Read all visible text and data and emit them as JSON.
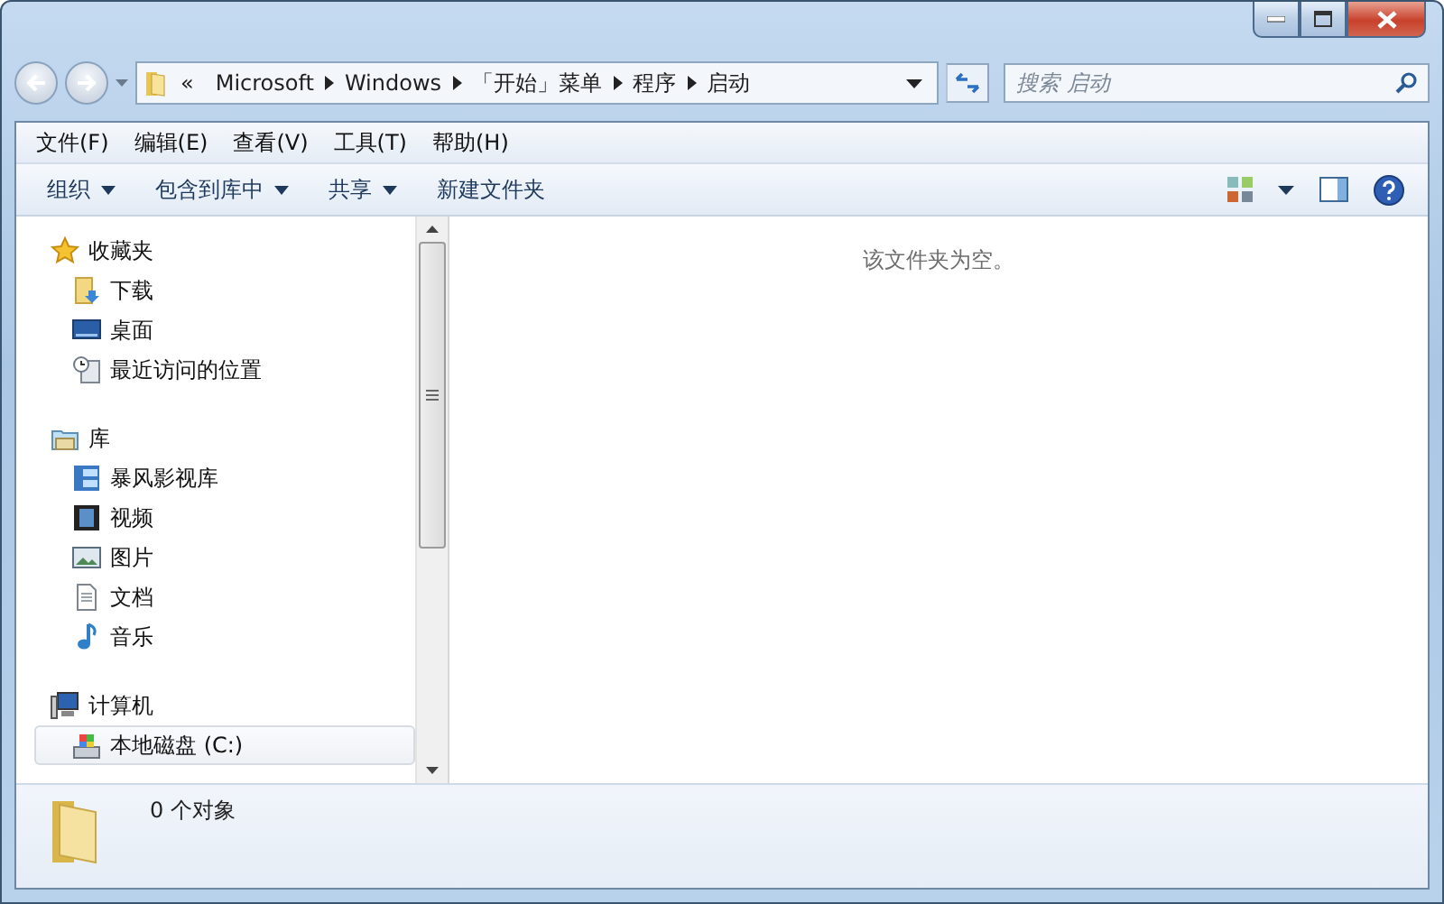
{
  "address": {
    "overflow": "«",
    "crumbs": [
      "Microsoft",
      "Windows",
      "「开始」菜单",
      "程序",
      "启动"
    ]
  },
  "search": {
    "placeholder": "搜索 启动"
  },
  "menu": [
    "文件(F)",
    "编辑(E)",
    "查看(V)",
    "工具(T)",
    "帮助(H)"
  ],
  "commands": [
    {
      "label": "组织",
      "dropdown": true
    },
    {
      "label": "包含到库中",
      "dropdown": true
    },
    {
      "label": "共享",
      "dropdown": true
    },
    {
      "label": "新建文件夹",
      "dropdown": false
    }
  ],
  "nav": [
    {
      "label": "收藏夹",
      "children": [
        {
          "label": "下载",
          "selected": false
        },
        {
          "label": "桌面",
          "selected": false
        },
        {
          "label": "最近访问的位置",
          "selected": false
        }
      ]
    },
    {
      "label": "库",
      "children": [
        {
          "label": "暴风影视库",
          "selected": false
        },
        {
          "label": "视频",
          "selected": false
        },
        {
          "label": "图片",
          "selected": false
        },
        {
          "label": "文档",
          "selected": false
        },
        {
          "label": "音乐",
          "selected": false
        }
      ]
    },
    {
      "label": "计算机",
      "children": [
        {
          "label": "本地磁盘 (C:)",
          "selected": true
        }
      ]
    }
  ],
  "empty_message": "该文件夹为空。",
  "status": "0 个对象"
}
